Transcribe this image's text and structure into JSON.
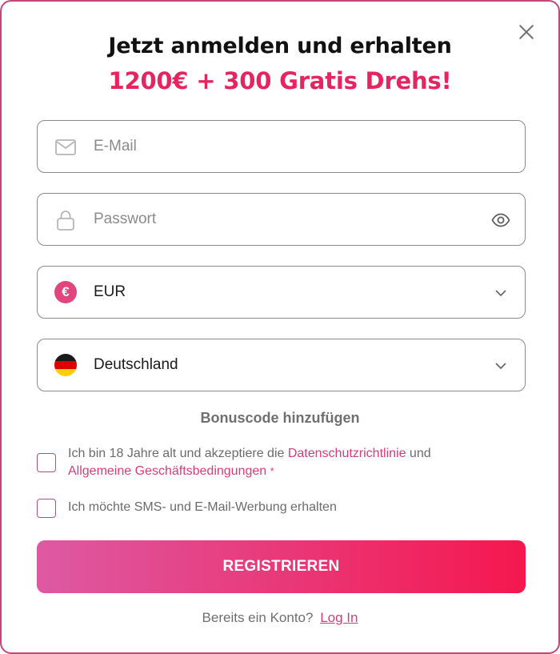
{
  "header": {
    "title": "Jetzt anmelden und erhalten",
    "subtitle": "1200€ + 300 Gratis Drehs!"
  },
  "form": {
    "email": {
      "placeholder": "E-Mail",
      "value": ""
    },
    "password": {
      "placeholder": "Passwort",
      "value": ""
    },
    "currency": {
      "selected": "EUR",
      "badge": "€"
    },
    "country": {
      "selected": "Deutschland"
    },
    "bonus_link": "Bonuscode hinzufügen",
    "terms": {
      "prefix": "Ich bin 18 Jahre alt und akzeptiere die ",
      "privacy_link": "Datenschutzrichtlinie",
      "middle": " und",
      "agb_link": "Allgemeine Geschäftsbedingungen",
      "required_mark": "*",
      "checked": false
    },
    "marketing": {
      "label": "Ich möchte SMS- und E-Mail-Werbung erhalten",
      "checked": false
    },
    "submit_label": "REGISTRIEREN"
  },
  "footer": {
    "question": "Bereits ein Konto?",
    "login_link": "Log In"
  },
  "icons": {
    "close": "close-icon",
    "email": "envelope-icon",
    "password": "lock-icon",
    "reveal": "eye-icon",
    "dropdown": "chevron-down-icon",
    "currency": "euro-icon",
    "flag": "germany-flag-icon"
  },
  "colors": {
    "accent": "#e6245f",
    "link": "#d43d7c",
    "button_gradient_start": "#dd5aa3",
    "button_gradient_end": "#f5174e",
    "border": "#c2487a"
  }
}
